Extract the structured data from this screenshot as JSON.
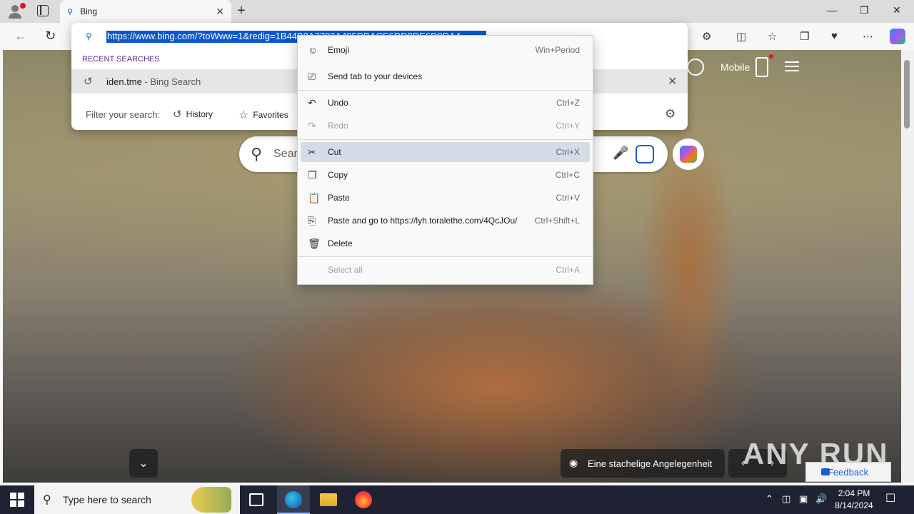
{
  "browser": {
    "tab": {
      "title": "Bing"
    },
    "window_controls": {
      "minimize": "—",
      "restore": "❐",
      "close": "✕"
    },
    "new_tab_label": "+"
  },
  "address_dropdown": {
    "url": "https://www.bing.com/?toWww=1&redig=1B44B0A7703A405DBACE6DD8DE6D9DA4",
    "recent_searches_label": "RECENT SEARCHES",
    "recent_item": {
      "query": "iden.tme",
      "suffix": " - Bing Search"
    },
    "filter_label": "Filter your search:",
    "filters": [
      {
        "label": "History",
        "icon": "history-icon"
      },
      {
        "label": "Favorites",
        "icon": "star-icon"
      }
    ]
  },
  "context_menu": {
    "items": [
      {
        "label": "Emoji",
        "shortcut": "Win+Period",
        "icon": "☺",
        "disabled": false
      },
      {
        "label": "Send tab to your devices",
        "shortcut": "",
        "icon": "⎚",
        "disabled": false
      },
      {
        "label": "Undo",
        "shortcut": "Ctrl+Z",
        "icon": "↶",
        "disabled": false
      },
      {
        "label": "Redo",
        "shortcut": "Ctrl+Y",
        "icon": "↷",
        "disabled": true
      },
      {
        "label": "Cut",
        "shortcut": "Ctrl+X",
        "icon": "✂",
        "disabled": false,
        "highlighted": true
      },
      {
        "label": "Copy",
        "shortcut": "Ctrl+C",
        "icon": "❐",
        "disabled": false
      },
      {
        "label": "Paste",
        "shortcut": "Ctrl+V",
        "icon": "📋",
        "disabled": false
      },
      {
        "label": "Paste and go to https://lyh.toralethe.com/4QcJOu/",
        "shortcut": "Ctrl+Shift+L",
        "icon": "⎘",
        "disabled": false
      },
      {
        "label": "Delete",
        "shortcut": "",
        "icon": "🗑",
        "disabled": false
      },
      {
        "label": "Select all",
        "shortcut": "Ctrl+A",
        "icon": "",
        "disabled": true
      }
    ]
  },
  "bing": {
    "search_placeholder": "Search",
    "mobile_label": "Mobile",
    "image_title": "Eine stachelige Angelegenheit",
    "feedback_label": "Feedback",
    "watermark": "ANY RUN"
  },
  "taskbar": {
    "search_placeholder": "Type here to search",
    "time": "2:04 PM",
    "date": "8/14/2024"
  },
  "colors": {
    "selection": "#0a57d0",
    "menu_highlight": "#d3dde8",
    "taskbar": "#1f2233",
    "recent_label": "#5b2a86"
  }
}
